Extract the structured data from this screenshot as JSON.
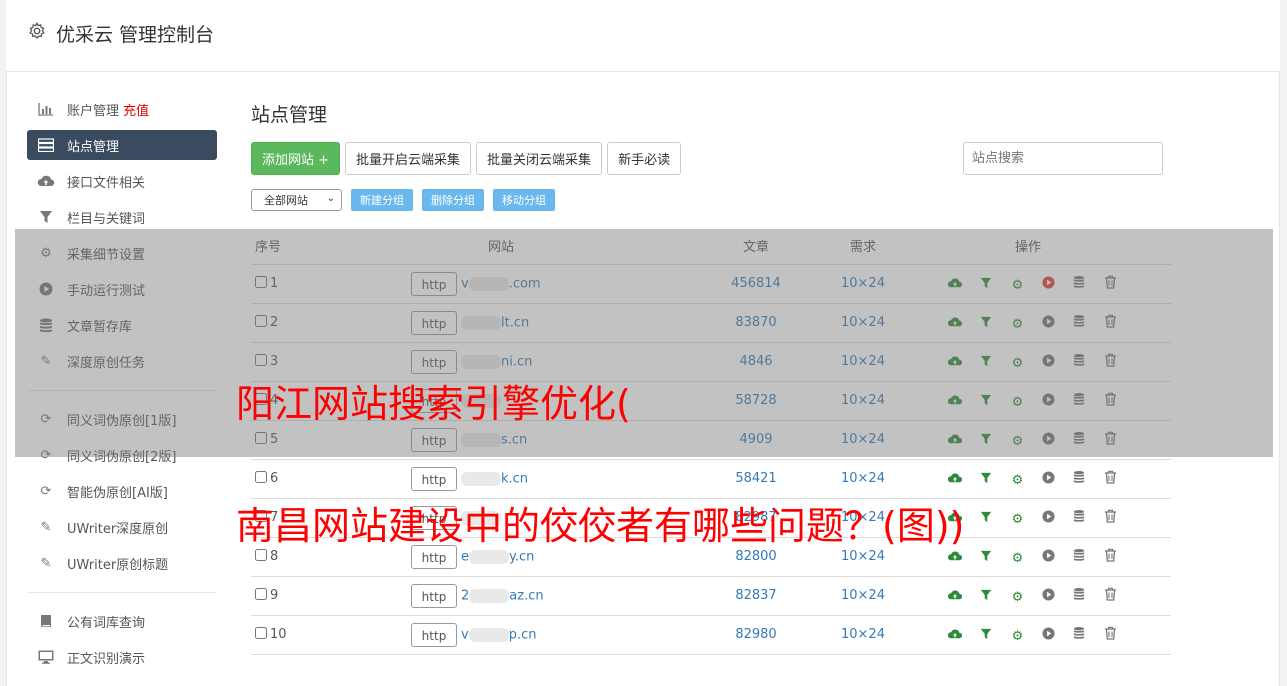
{
  "header": {
    "title": "优采云 管理控制台"
  },
  "sidebar": {
    "items": [
      {
        "label": "账户管理",
        "extra": "充值",
        "icon": "bar-chart-icon"
      },
      {
        "label": "站点管理",
        "icon": "server-icon",
        "active": true
      },
      {
        "label": "接口文件相关",
        "icon": "cloud-upload-icon"
      },
      {
        "label": "栏目与关键词",
        "icon": "filter-icon"
      },
      {
        "label": "采集细节设置",
        "icon": "cogs-icon"
      },
      {
        "label": "手动运行测试",
        "icon": "play-icon"
      },
      {
        "label": "文章暂存库",
        "icon": "database-icon"
      },
      {
        "label": "深度原创任务",
        "icon": "edit-icon"
      },
      {
        "label": "同义词伪原创[1版]",
        "icon": "refresh-icon"
      },
      {
        "label": "同义词伪原创[2版]",
        "icon": "refresh-icon"
      },
      {
        "label": "智能伪原创[AI版]",
        "icon": "refresh-icon"
      },
      {
        "label": "UWriter深度原创",
        "icon": "edit-icon"
      },
      {
        "label": "UWriter原创标题",
        "icon": "edit-icon"
      },
      {
        "label": "公有词库查询",
        "icon": "book-icon"
      },
      {
        "label": "正文识别演示",
        "icon": "monitor-icon"
      }
    ]
  },
  "main": {
    "title": "站点管理",
    "buttons": {
      "add": "添加网站 +",
      "batch_on": "批量开启云端采集",
      "batch_off": "批量关闭云端采集",
      "guide": "新手必读"
    },
    "search_placeholder": "站点搜索",
    "group_select": "全部网站",
    "group_buttons": {
      "new": "新建分组",
      "delete": "删除分组",
      "move": "移动分组"
    },
    "table": {
      "headers": {
        "num": "序号",
        "site": "网站",
        "articles": "文章",
        "demand": "需求",
        "ops": "操作"
      },
      "rows": [
        {
          "num": "1",
          "protocol": "http",
          "prefix": "v",
          "suffix": ".com",
          "articles": "456814",
          "demand": "10×24",
          "running": true
        },
        {
          "num": "2",
          "protocol": "http",
          "prefix": "",
          "suffix": "lt.cn",
          "articles": "83870",
          "demand": "10×24",
          "running": false
        },
        {
          "num": "3",
          "protocol": "http",
          "prefix": "",
          "suffix": "ni.cn",
          "articles": "4846",
          "demand": "10×24",
          "running": false
        },
        {
          "num": "4",
          "protocol": "http",
          "prefix": "",
          "suffix": "",
          "articles": "58728",
          "demand": "10×24",
          "running": false
        },
        {
          "num": "5",
          "protocol": "http",
          "prefix": "",
          "suffix": "s.cn",
          "articles": "4909",
          "demand": "10×24",
          "running": false
        },
        {
          "num": "6",
          "protocol": "http",
          "prefix": "",
          "suffix": "k.cn",
          "articles": "58421",
          "demand": "10×24",
          "running": false
        },
        {
          "num": "7",
          "protocol": "http",
          "prefix": "",
          "suffix": "",
          "articles": "82987",
          "demand": "10×24",
          "running": false
        },
        {
          "num": "8",
          "protocol": "http",
          "prefix": "e",
          "suffix": "y.cn",
          "articles": "82800",
          "demand": "10×24",
          "running": false
        },
        {
          "num": "9",
          "protocol": "http",
          "prefix": "2",
          "suffix": "az.cn",
          "articles": "82837",
          "demand": "10×24",
          "running": false
        },
        {
          "num": "10",
          "protocol": "http",
          "prefix": "v",
          "suffix": "p.cn",
          "articles": "82980",
          "demand": "10×24",
          "running": false
        }
      ]
    }
  },
  "overlay": {
    "line1": "阳江网站搜索引擎优化(",
    "line2": "南昌网站建设中的佼佼者有哪些问题？(图))"
  }
}
